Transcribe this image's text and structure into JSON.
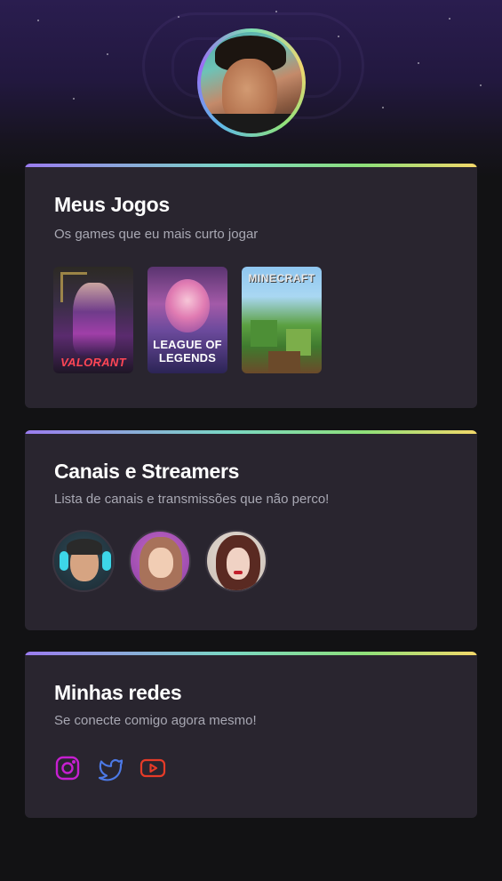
{
  "profile": {
    "avatar_icon": "profile-photo"
  },
  "sections": {
    "games": {
      "title": "Meus Jogos",
      "subtitle": "Os games que eu mais curto jogar",
      "items": [
        {
          "name": "VALORANT",
          "logo": "VALORANT"
        },
        {
          "name": "League of Legends",
          "logo_line1": "LEAGUE OF",
          "logo_line2": "LEGENDS"
        },
        {
          "name": "Minecraft",
          "logo": "MINECRAFT"
        }
      ]
    },
    "channels": {
      "title": "Canais e Streamers",
      "subtitle": "Lista de canais e transmissões que não perco!",
      "items": [
        {
          "icon": "streamer-avatar-1"
        },
        {
          "icon": "streamer-avatar-2"
        },
        {
          "icon": "streamer-avatar-3"
        }
      ]
    },
    "social": {
      "title": "Minhas redes",
      "subtitle": "Se conecte comigo agora mesmo!",
      "items": [
        {
          "icon": "instagram-icon",
          "color": "#c71fd1"
        },
        {
          "icon": "twitter-icon",
          "color": "#4c79e6"
        },
        {
          "icon": "youtube-icon",
          "color": "#e53b28"
        }
      ]
    }
  },
  "theme": {
    "background": "#121214",
    "card": "#29252f",
    "subtitle_color": "#a8a8b3",
    "accent_gradient": [
      "#9b7cf0",
      "#7ad7c4",
      "#8ee07a",
      "#f3d86a"
    ]
  }
}
